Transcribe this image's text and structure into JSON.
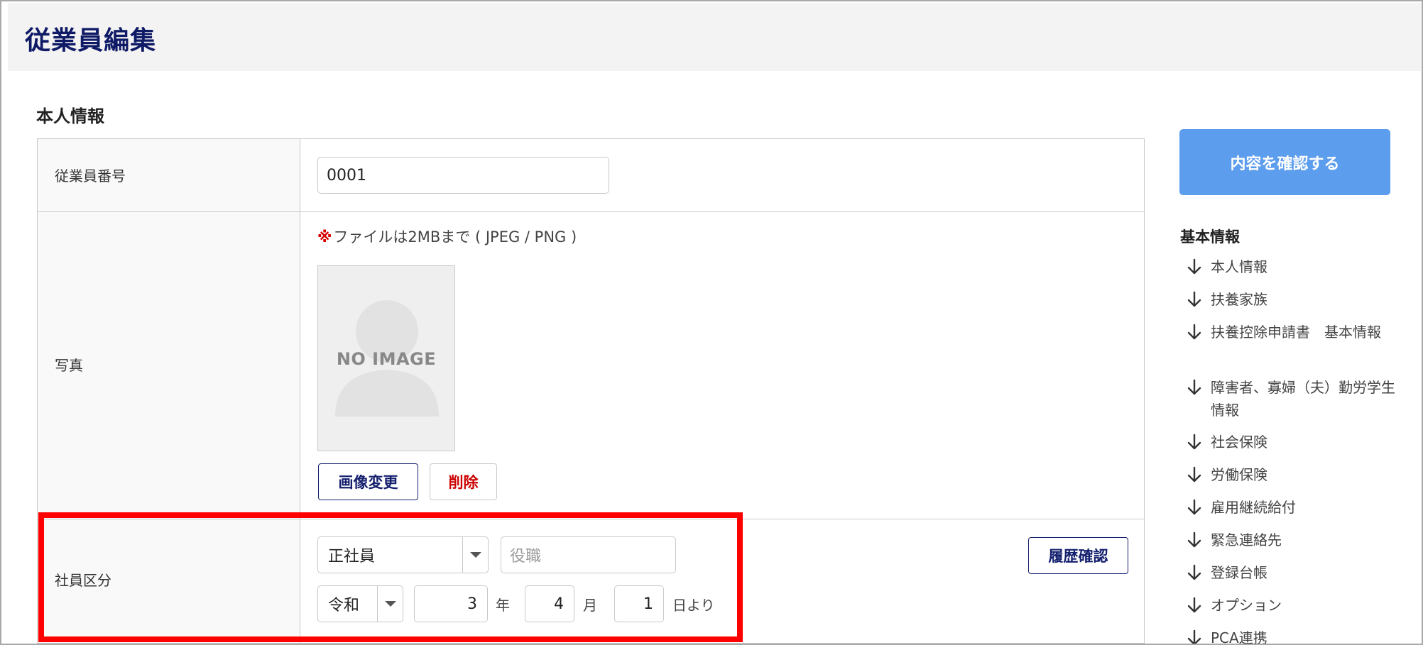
{
  "page": {
    "title": "従業員編集"
  },
  "section": {
    "title": "本人情報"
  },
  "employee_number": {
    "label": "従業員番号",
    "value": "0001"
  },
  "photo": {
    "label": "写真",
    "note_mark": "※",
    "note_text": "ファイルは2MBまで ( JPEG / PNG )",
    "placeholder_text": "NO IMAGE",
    "change_button": "画像変更",
    "delete_button": "削除"
  },
  "employment_status": {
    "label": "社員区分",
    "type_value": "正社員",
    "position_placeholder": "役職",
    "history_button": "履歴確認",
    "era_value": "令和",
    "year_value": "3",
    "year_unit": "年",
    "month_value": "4",
    "month_unit": "月",
    "day_value": "1",
    "day_unit": "日より"
  },
  "sidebar": {
    "confirm_button": "内容を確認する",
    "heading": "基本情報",
    "items": [
      {
        "label": "本人情報"
      },
      {
        "label": "扶養家族"
      },
      {
        "label": "扶養控除申請書　基本情報"
      },
      {
        "label": "障害者、寡婦（夫）勤労学生情報"
      },
      {
        "label": "社会保険"
      },
      {
        "label": "労働保険"
      },
      {
        "label": "雇用継続給付"
      },
      {
        "label": "緊急連絡先"
      },
      {
        "label": "登録台帳"
      },
      {
        "label": "オプション"
      },
      {
        "label": "PCA連携"
      }
    ],
    "item_icon": "arrow-down-icon"
  },
  "colors": {
    "title_navy": "#0f1a66",
    "confirm_blue": "#5c9ded",
    "delete_red": "#cc0000",
    "highlight_red": "#ff0000"
  }
}
